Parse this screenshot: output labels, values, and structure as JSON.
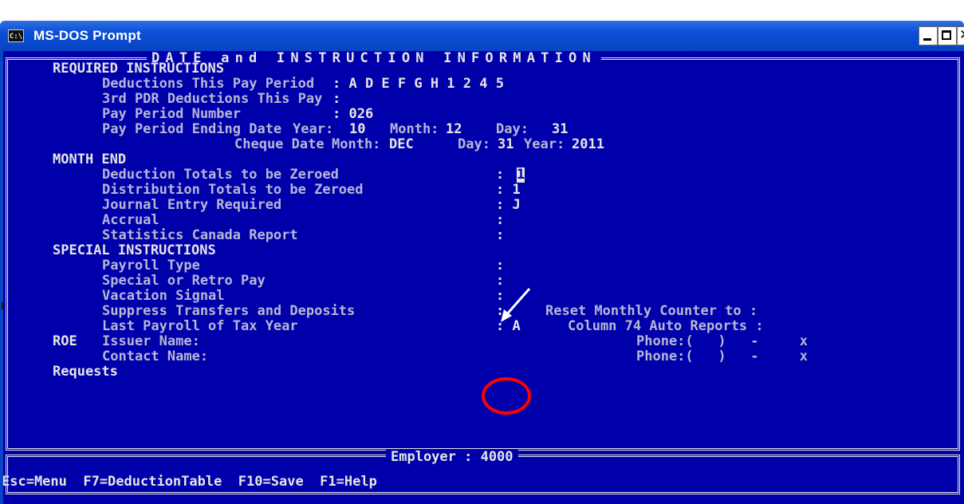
{
  "window": {
    "title": "MS-DOS Prompt",
    "icon_text": "C:\\"
  },
  "screen": {
    "header": "DATE and INSTRUCTION INFORMATION",
    "sections": {
      "required": "REQUIRED INSTRUCTIONS",
      "month_end": "MONTH END",
      "special": "SPECIAL INSTRUCTIONS"
    },
    "required": {
      "deductions_label": "Deductions This Pay Period",
      "deductions_value": ": A D E F G H 1 2 4 5",
      "pdr_label": "3rd PDR Deductions This Pay",
      "pdr_value": ":",
      "pay_period_number_label": "Pay Period Number",
      "pay_period_number_value": ": 026",
      "ending_date_label": "Pay Period Ending Date",
      "ending_year_label": "Year:",
      "ending_year_value": "10",
      "ending_month_label": "Month:",
      "ending_month_value": "12",
      "ending_day_label": "Day:",
      "ending_day_value": "31",
      "cheque_date_label": "Cheque Date",
      "cheque_month_label": "Month:",
      "cheque_month_value": "DEC",
      "cheque_day_label": "Day:",
      "cheque_day_value": "31",
      "cheque_year_label": "Year:",
      "cheque_year_value": "2011"
    },
    "month_end": {
      "deduction_totals_label": "Deduction Totals to be Zeroed",
      "deduction_totals_colon": ":",
      "deduction_totals_value": "1",
      "distribution_totals_label": "Distribution Totals to be Zeroed",
      "distribution_totals_value": ": 1",
      "journal_entry_label": "Journal Entry Required",
      "journal_entry_value": ": J",
      "accrual_label": "Accrual",
      "accrual_value": ":",
      "statscan_label": "Statistics Canada Report",
      "statscan_value": ":"
    },
    "special": {
      "payroll_type_label": "Payroll Type",
      "payroll_type_value": ":",
      "retro_label": "Special or Retro Pay",
      "retro_value": ":",
      "vacation_label": "Vacation Signal",
      "vacation_value": ":",
      "suppress_label": "Suppress Transfers and Deposits",
      "suppress_value": ":",
      "reset_counter_label": "Reset Monthly Counter to :",
      "last_payroll_label": "Last Payroll of Tax Year",
      "last_payroll_value": ": A",
      "col74_label": "Column 74 Auto Reports :"
    },
    "roe": {
      "roe_label": "ROE",
      "issuer_label": "Issuer Name:",
      "contact_label": "Contact Name:",
      "issuer_phone": "Phone:(   )   -     x",
      "contact_phone": "Phone:(   )   -     x"
    },
    "requests_label": "Requests",
    "employer": "Employer : 4000"
  },
  "fkeys": "Esc=Menu  F7=DeductionTable  F10=Save  F1=Help",
  "colors": {
    "console_bg": "#0000aa",
    "console_text": "#e6e6e6",
    "titlebar": "#0a4ed6",
    "annotation": "#ff0000"
  }
}
